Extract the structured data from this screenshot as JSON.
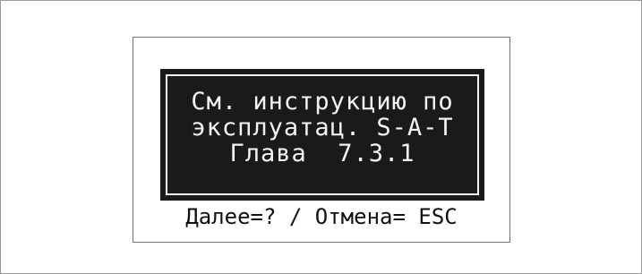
{
  "display": {
    "message_lines": [
      "См. инструкцию по",
      "эксплуатац. S-A-T",
      "Глава  7.3.1"
    ],
    "prompt": "Далее=? / Отмена= ESC"
  },
  "colors": {
    "screen_background": "#ffffff",
    "message_background": "#1a1a1a",
    "message_text": "#f4f4f4",
    "prompt_text": "#111111"
  }
}
